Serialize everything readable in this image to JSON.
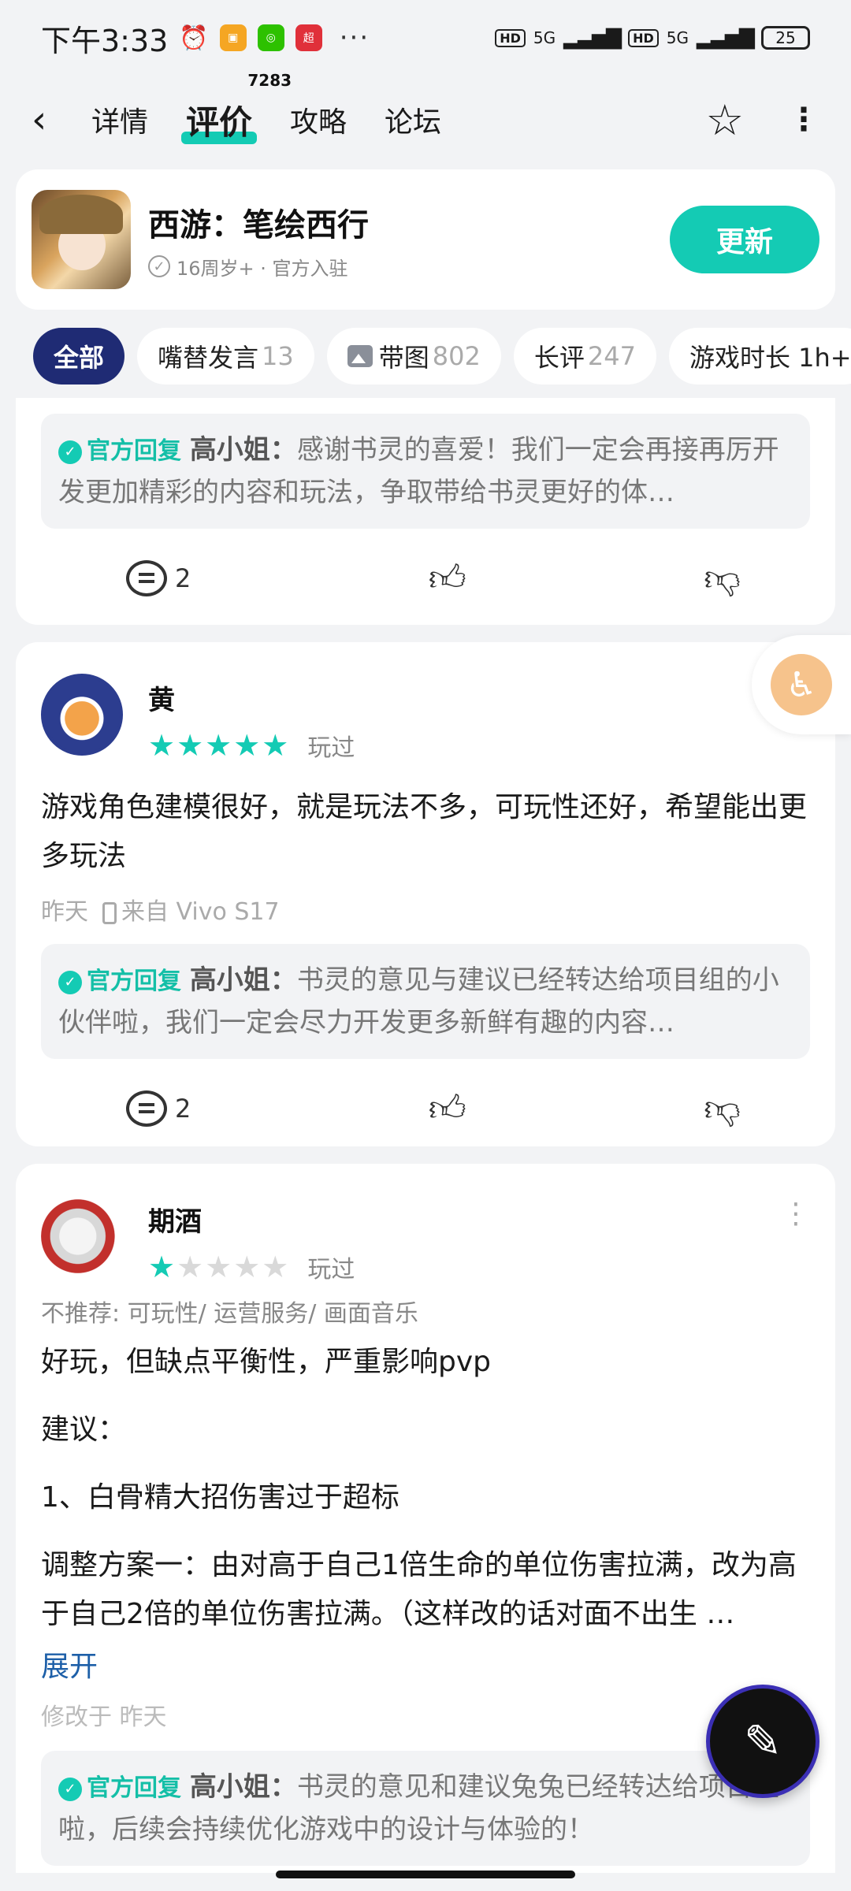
{
  "status": {
    "time": "下午3:33",
    "app_icons": [
      "alarm-icon",
      "app-orange-icon",
      "wechat-icon",
      "supermarket-app-icon"
    ],
    "more": "···",
    "hd1": "HD",
    "sig1": "5G",
    "hd2": "HD",
    "sig2": "5G",
    "battery": "25"
  },
  "nav": {
    "back": "‹",
    "tabs": [
      {
        "label": "详情"
      },
      {
        "label": "评价",
        "badge": "7283"
      },
      {
        "label": "攻略"
      },
      {
        "label": "论坛"
      }
    ]
  },
  "game": {
    "title": "西游：笔绘西行",
    "meta": "16周岁+ · 官方入驻",
    "update_label": "更新"
  },
  "filters": [
    {
      "label": "全部",
      "count": ""
    },
    {
      "label": "嘴替发言",
      "count": "13"
    },
    {
      "label": "带图",
      "count": "802"
    },
    {
      "label": "长评",
      "count": "247"
    },
    {
      "label": "游戏时长 1h+",
      "count": ""
    }
  ],
  "card1": {
    "reply_tag": "官方回复",
    "reply_name": "高小姐：",
    "reply_text": "感谢书灵的喜爱！我们一定会再接再厉开发更加精彩的内容和玩法，争取带给书灵更好的体…",
    "comments": "2"
  },
  "card2": {
    "username": "黄",
    "stars": 5,
    "played": "玩过",
    "text": "游戏角色建模很好，就是玩法不多，可玩性还好，希望能出更多玩法",
    "date": "昨天",
    "device": "来自 Vivo S17",
    "reply_tag": "官方回复",
    "reply_name": "高小姐：",
    "reply_text": "书灵的意见与建议已经转达给项目组的小伙伴啦，我们一定会尽力开发更多新鲜有趣的内容…",
    "comments": "2"
  },
  "card3": {
    "username": "期酒",
    "stars": 1,
    "played": "玩过",
    "tags": "不推荐: 可玩性/ 运营服务/ 画面音乐",
    "p1": "好玩，但缺点平衡性，严重影响pvp",
    "p2": "建议：",
    "p3": "1、白骨精大招伤害过于超标",
    "p4": "调整方案一：由对高于自己1倍生命的单位伤害拉满，改为高于自己2倍的单位伤害拉满。（这样改的话对面不出生 …",
    "expand": "展开",
    "edit_time": "修改于 昨天",
    "reply_tag": "官方回复",
    "reply_name": "高小姐：",
    "reply_text": "书灵的意见和建议兔兔已经转达给项目组啦，后续会持续优化游戏中的设计与体验的！"
  },
  "colors": {
    "accent": "#14cbb4",
    "chip_active": "#1f2b74",
    "link": "#1d5fa8"
  }
}
